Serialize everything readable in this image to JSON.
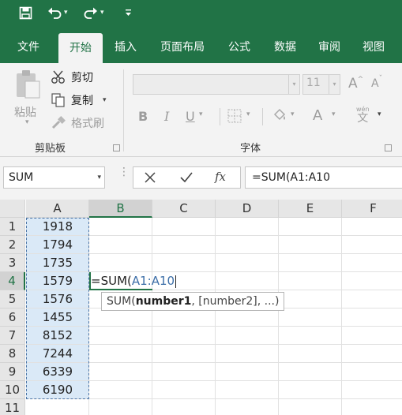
{
  "qat": {
    "save_icon": "save-icon",
    "undo_icon": "undo-icon",
    "redo_icon": "redo-icon",
    "customize_icon": "customize-qat-icon"
  },
  "tabs": [
    "文件",
    "开始",
    "插入",
    "页面布局",
    "公式",
    "数据",
    "审阅",
    "视图"
  ],
  "active_tab": "开始",
  "clipboard": {
    "paste": "粘贴",
    "cut": "剪切",
    "copy": "复制",
    "format_painter": "格式刷",
    "group_label": "剪贴板"
  },
  "font": {
    "font_size": "11",
    "bold": "B",
    "italic": "I",
    "underline": "U",
    "grow": "A",
    "shrink": "A",
    "font_color": "A",
    "phonetic": "文",
    "phonetic_top": "wén",
    "group_label": "字体"
  },
  "formula_bar": {
    "name_box": "SUM",
    "cancel_icon": "cancel-icon",
    "enter_icon": "enter-icon",
    "fx": "fx",
    "content": "=SUM(A1:A10"
  },
  "columns": [
    "A",
    "B",
    "C",
    "D",
    "E",
    "F"
  ],
  "rows": [
    "1",
    "2",
    "3",
    "4",
    "5",
    "6",
    "7",
    "8",
    "9",
    "10",
    "11"
  ],
  "column_a_values": [
    "1918",
    "1794",
    "1735",
    "1579",
    "1576",
    "1455",
    "8152",
    "7244",
    "6339",
    "6190"
  ],
  "editing_cell": {
    "prefix": "=SUM(",
    "reference": "A1:A10"
  },
  "tooltip": {
    "func": "SUM(",
    "arg1": "number1",
    "rest": ", [number2], ...)"
  },
  "colors": {
    "excel_green": "#217346",
    "reference_blue": "#3d6fa8",
    "highlight": "#dae9f7"
  }
}
